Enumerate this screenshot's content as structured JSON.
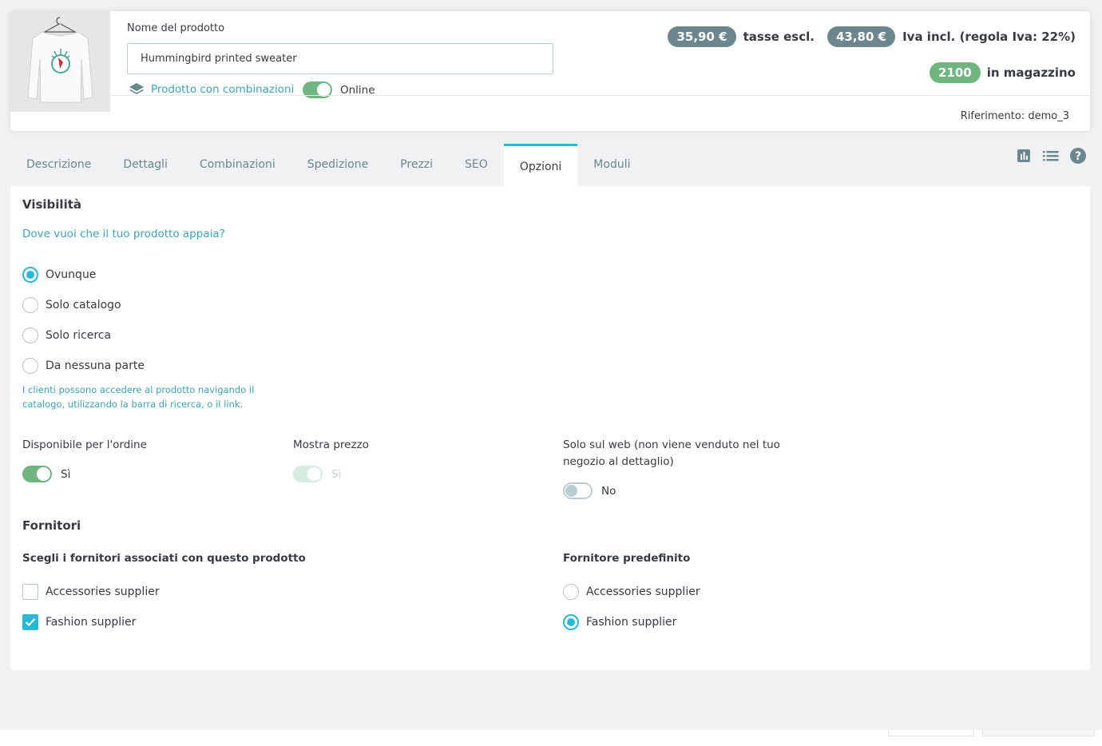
{
  "header": {
    "name_label": "Nome del prodotto",
    "name_value": "Hummingbird printed sweater",
    "combinations_label": "Prodotto con combinazioni",
    "online_label": "Online",
    "price_excl": "35,90 €",
    "price_excl_label": "tasse escl.",
    "price_incl": "43,80 €",
    "price_incl_label": "Iva incl. (regola Iva: 22%)",
    "stock_qty": "2100",
    "stock_label": "in magazzino",
    "reference": "Riferimento: demo_3"
  },
  "tabs": [
    {
      "label": "Descrizione"
    },
    {
      "label": "Dettagli"
    },
    {
      "label": "Combinazioni"
    },
    {
      "label": "Spedizione"
    },
    {
      "label": "Prezzi"
    },
    {
      "label": "SEO"
    },
    {
      "label": "Opzioni"
    },
    {
      "label": "Moduli"
    }
  ],
  "active_tab": "Opzioni",
  "tab_icons": [
    "stats-icon",
    "list-icon",
    "help-icon"
  ],
  "visibility": {
    "title": "Visibilità",
    "question": "Dove vuoi che il tuo prodotto appaia?",
    "options": [
      {
        "label": "Ovunque",
        "checked": true
      },
      {
        "label": "Solo catalogo",
        "checked": false
      },
      {
        "label": "Solo ricerca",
        "checked": false
      },
      {
        "label": "Da nessuna parte",
        "checked": false
      }
    ],
    "help": "I clienti possono accedere al prodotto navigando il catalogo, utilizzando la barra di ricerca, o il link."
  },
  "fields": {
    "available_label": "Disponibile per l'ordine",
    "available_value": "Sì",
    "show_price_label": "Mostra prezzo",
    "show_price_value": "Sì",
    "web_only_label": "Solo sul web (non viene venduto nel tuo negozio al dettaglio)",
    "web_only_value": "No"
  },
  "suppliers": {
    "title": "Fornitori",
    "choose_label": "Scegli i fornitori associati con questo prodotto",
    "default_label": "Fornitore predefinito",
    "list": [
      {
        "label": "Accessories supplier",
        "associated": false,
        "default": false
      },
      {
        "label": "Fashion supplier",
        "associated": true,
        "default": true
      }
    ]
  },
  "colors": {
    "accent": "#25b9d7",
    "success": "#70b580",
    "badge": "#6c868e"
  }
}
